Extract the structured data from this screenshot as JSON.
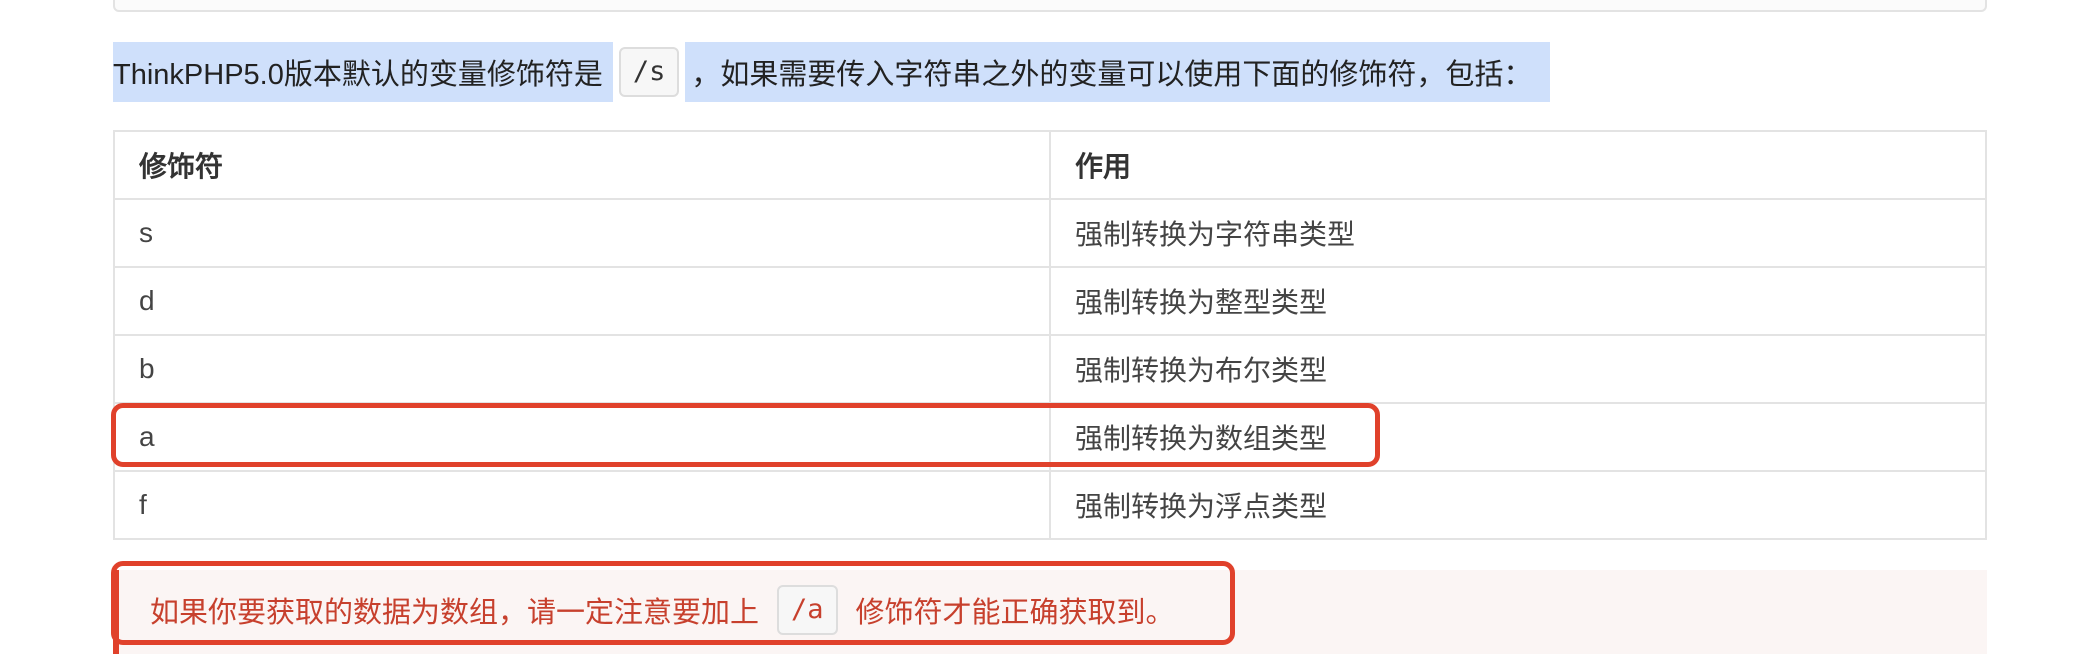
{
  "intro": {
    "text_before": "ThinkPHP5.0版本默认的变量修饰符是",
    "code": "/s",
    "text_after": "，如果需要传入字符串之外的变量可以使用下面的修饰符，包括："
  },
  "table": {
    "headers": [
      "修饰符",
      "作用"
    ],
    "rows": [
      [
        "s",
        "强制转换为字符串类型"
      ],
      [
        "d",
        "强制转换为整型类型"
      ],
      [
        "b",
        "强制转换为布尔类型"
      ],
      [
        "a",
        "强制转换为数组类型"
      ],
      [
        "f",
        "强制转换为浮点类型"
      ]
    ]
  },
  "note": {
    "text_before": "如果你要获取的数据为数组，请一定注意要加上",
    "code": "/a",
    "text_after": "修饰符才能正确获取到。"
  },
  "colors": {
    "highlight": "#cfe0fb",
    "annotation_red": "#e0412b",
    "note_text": "#c7402d",
    "note_background": "#fbf5f4"
  }
}
